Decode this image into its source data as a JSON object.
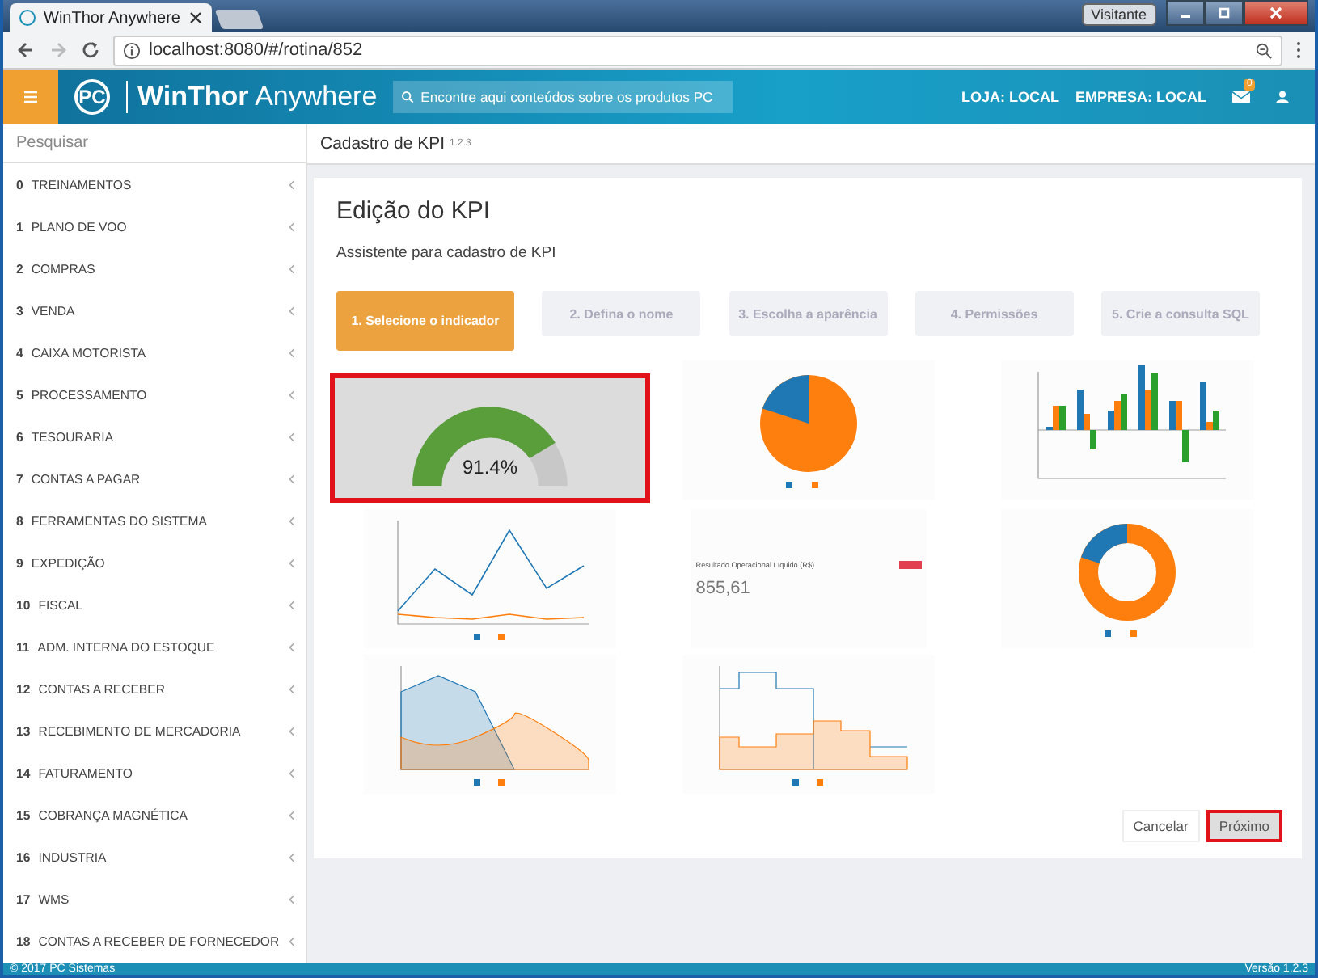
{
  "browser": {
    "tab_title": "WinThor Anywhere",
    "profile": "Visitante",
    "url": "localhost:8080/#/rotina/852"
  },
  "header": {
    "logo": "PC",
    "app_name": "**WinThor** Anywhere",
    "search": {
      "placeholder": "Encontre aqui conteúdos sobre os produtos PC"
    },
    "store": "LOJA: LOCAL",
    "company": "EMPRESA: LOCAL",
    "mail_badge": "0"
  },
  "sidebar": {
    "search": {
      "placeholder": "Pesquisar"
    },
    "items": [
      {
        "number": "0",
        "label": "TREINAMENTOS"
      },
      {
        "number": "1",
        "label": "PLANO DE VOO"
      },
      {
        "number": "2",
        "label": "COMPRAS"
      },
      {
        "number": "3",
        "label": "VENDA"
      },
      {
        "number": "4",
        "label": "CAIXA MOTORISTA"
      },
      {
        "number": "5",
        "label": "PROCESSAMENTO"
      },
      {
        "number": "6",
        "label": "TESOURARIA"
      },
      {
        "number": "7",
        "label": "CONTAS A PAGAR"
      },
      {
        "number": "8",
        "label": "FERRAMENTAS DO SISTEMA"
      },
      {
        "number": "9",
        "label": "EXPEDIÇÃO"
      },
      {
        "number": "10",
        "label": "FISCAL"
      },
      {
        "number": "11",
        "label": "ADM. INTERNA DO ESTOQUE"
      },
      {
        "number": "12",
        "label": "CONTAS A RECEBER"
      },
      {
        "number": "13",
        "label": "RECEBIMENTO DE MERCADORIA"
      },
      {
        "number": "14",
        "label": "FATURAMENTO"
      },
      {
        "number": "15",
        "label": "COBRANÇA MAGNÉTICA"
      },
      {
        "number": "16",
        "label": "INDUSTRIA"
      },
      {
        "number": "17",
        "label": "WMS"
      },
      {
        "number": "18",
        "label": "CONTAS A RECEBER DE FORNECEDOR"
      }
    ]
  },
  "breadcrumb": {
    "title": "Cadastro de KPI",
    "version": "1.2.3"
  },
  "page": {
    "title": "Edição do KPI",
    "subtitle": "Assistente para cadastro de KPI"
  },
  "steps": [
    {
      "label": "1. Selecione o indicador",
      "selected": true
    },
    {
      "label": "2. Defina o nome",
      "selected": false
    },
    {
      "label": "3. Escolha a aparência",
      "selected": false
    },
    {
      "label": "4. Permissões",
      "selected": false
    },
    {
      "label": "5. Crie a consulta SQL",
      "selected": false
    }
  ],
  "indicators": [
    {
      "kind": "gauge",
      "value": "91.4%",
      "selected": true
    },
    {
      "kind": "pie",
      "selected": false
    },
    {
      "kind": "bar",
      "selected": false
    },
    {
      "kind": "line",
      "selected": false
    },
    {
      "kind": "kpi",
      "title": "Resultado Operacional Líquido (R$)",
      "value": "855,61",
      "selected": false
    },
    {
      "kind": "donut",
      "selected": false
    },
    {
      "kind": "area",
      "selected": false
    },
    {
      "kind": "step",
      "selected": false
    }
  ],
  "buttons": [
    {
      "label": "Cancelar",
      "highlighted": false
    },
    {
      "label": "Próximo",
      "highlighted": true
    }
  ],
  "footer": {
    "copyright": "© 2017 PC Sistemas",
    "version": "Versão 1.2.3"
  }
}
